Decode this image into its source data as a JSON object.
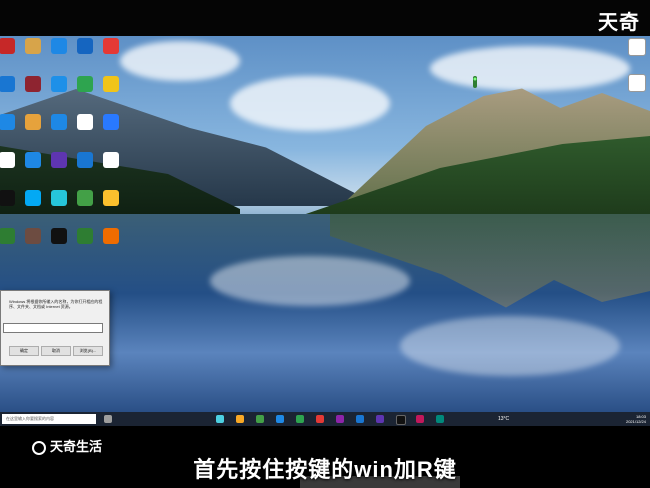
{
  "header": {
    "brand": "天奇"
  },
  "desktop": {
    "icons": [
      {
        "label": "",
        "color": "#c62828"
      },
      {
        "label": "",
        "color": "#d7a44a"
      },
      {
        "label": "",
        "color": "#1e88e5"
      },
      {
        "label": "",
        "color": "#1565c0"
      },
      {
        "label": "",
        "color": "#e53935"
      },
      {
        "label": "",
        "color": "#1976d2"
      },
      {
        "label": "",
        "color": "#8e2430"
      },
      {
        "label": "",
        "color": "#1e90e8"
      },
      {
        "label": "",
        "color": "#2ea44f"
      },
      {
        "label": "",
        "color": "#f0c419"
      },
      {
        "label": "",
        "color": "#1e88e5"
      },
      {
        "label": "",
        "color": "#e6a23c"
      },
      {
        "label": "",
        "color": "#1e88e5"
      },
      {
        "label": "",
        "color": "#ffffff"
      },
      {
        "label": "",
        "color": "#2979ff"
      },
      {
        "label": "",
        "color": "#ffffff"
      },
      {
        "label": "",
        "color": "#1e88e5"
      },
      {
        "label": "",
        "color": "#5e35b1"
      },
      {
        "label": "",
        "color": "#1976d2"
      },
      {
        "label": "",
        "color": "#ffffff"
      },
      {
        "label": "",
        "color": "#111111"
      },
      {
        "label": "",
        "color": "#03a9f4"
      },
      {
        "label": "",
        "color": "#26c6da"
      },
      {
        "label": "",
        "color": "#43a047"
      },
      {
        "label": "",
        "color": "#fbc02d"
      },
      {
        "label": "",
        "color": "#2e7d32"
      },
      {
        "label": "",
        "color": "#6d4c41"
      },
      {
        "label": "",
        "color": "#111111"
      },
      {
        "label": "",
        "color": "#2e7d32"
      },
      {
        "label": "",
        "color": "#ef6c00"
      }
    ]
  },
  "run_dialog": {
    "text": "Windows 将根据你所输入的名称，为你打开相应的程序、文件夹、文档或 Internet 资源。",
    "input_value": "",
    "ok_label": "确定",
    "cancel_label": "取消",
    "browse_label": "浏览(B)..."
  },
  "taskbar": {
    "search_placeholder": "在这里输入你要搜索的内容",
    "temperature": "13°C",
    "time": "18:03",
    "date": "2021/12/24"
  },
  "footer": {
    "logo_text": "天奇生活",
    "caption": "首先按住按键的win加R键"
  },
  "colors": {
    "taskbar": "#1b2433",
    "dialog_bg": "#f0f0f0"
  }
}
